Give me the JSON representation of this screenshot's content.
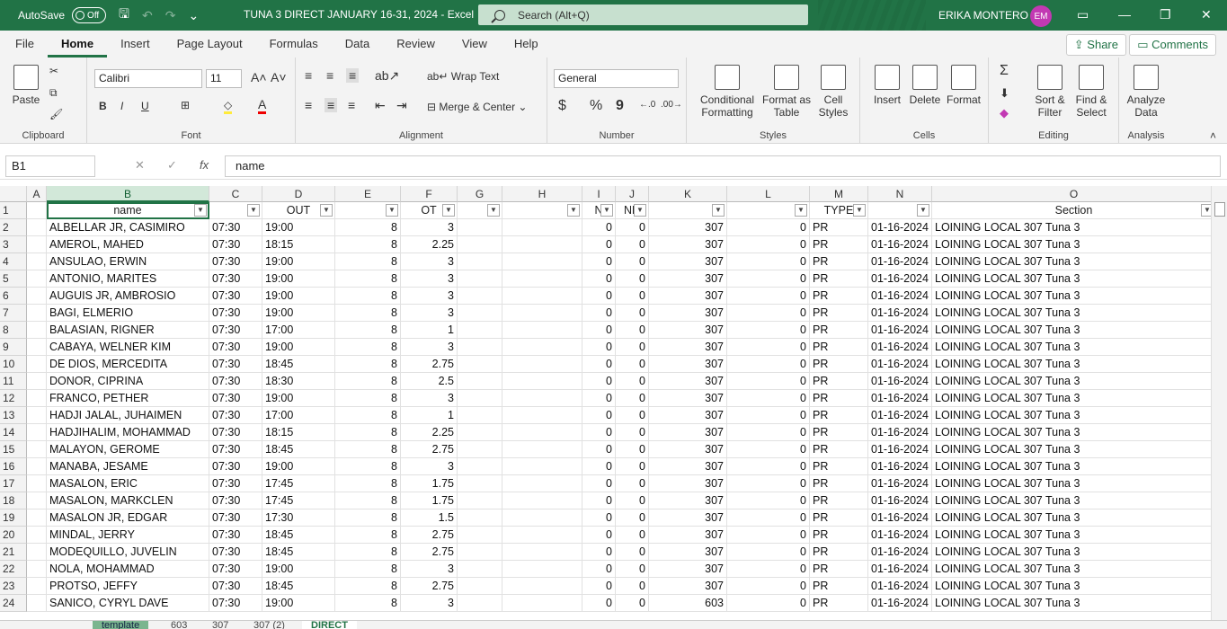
{
  "titlebar": {
    "autosave_label": "AutoSave",
    "autosave_state": "Off",
    "doc_title": "TUNA 3 DIRECT  JANUARY 16-31, 2024  -  Excel",
    "search_placeholder": "Search (Alt+Q)",
    "user_name": "ERIKA MONTERO",
    "user_initials": "EM"
  },
  "menu": [
    "File",
    "Home",
    "Insert",
    "Page Layout",
    "Formulas",
    "Data",
    "Review",
    "View",
    "Help"
  ],
  "share_label": "Share",
  "comments_label": "Comments",
  "ribbon": {
    "clipboard": {
      "paste": "Paste",
      "label": "Clipboard"
    },
    "font": {
      "name": "Calibri",
      "size": "11",
      "label": "Font",
      "bold": "B",
      "italic": "I",
      "underline": "U"
    },
    "alignment": {
      "wrap": "Wrap Text",
      "merge": "Merge & Center",
      "label": "Alignment"
    },
    "number": {
      "format": "General",
      "currency": "$",
      "percent": "%",
      "comma": "9",
      "label": "Number"
    },
    "styles": {
      "conditional": "Conditional Formatting",
      "format_table": "Format as Table",
      "cell_styles": "Cell Styles",
      "label": "Styles"
    },
    "cells": {
      "insert": "Insert",
      "delete": "Delete",
      "format": "Format",
      "label": "Cells"
    },
    "editing": {
      "sort": "Sort & Filter",
      "find": "Find & Select",
      "label": "Editing"
    },
    "analysis": {
      "analyze": "Analyze Data",
      "label": "Analysis"
    }
  },
  "formula_bar": {
    "name_box": "B1",
    "fx": "fx",
    "content": "name"
  },
  "columns": [
    "A",
    "B",
    "C",
    "D",
    "E",
    "F",
    "G",
    "H",
    "I",
    "J",
    "K",
    "L",
    "M",
    "N",
    "O"
  ],
  "header_row": {
    "B": "name",
    "D": "OUT",
    "F": "OT",
    "I": "N",
    "J": "ND",
    "M": "TYPE",
    "O": "Section"
  },
  "rows": [
    {
      "num": "2",
      "B": "ALBELLAR JR, CASIMIRO",
      "C": "07:30",
      "D": "19:00",
      "E": "8",
      "F": "3",
      "I": "0",
      "J": "0",
      "K": "307",
      "L": "0",
      "M": "PR",
      "N": "01-16-2024",
      "O": "LOINING LOCAL 307 Tuna 3"
    },
    {
      "num": "3",
      "B": "AMEROL, MAHED",
      "C": "07:30",
      "D": "18:15",
      "E": "8",
      "F": "2.25",
      "I": "0",
      "J": "0",
      "K": "307",
      "L": "0",
      "M": "PR",
      "N": "01-16-2024",
      "O": "LOINING LOCAL 307 Tuna 3"
    },
    {
      "num": "4",
      "B": "ANSULAO, ERWIN",
      "C": "07:30",
      "D": "19:00",
      "E": "8",
      "F": "3",
      "I": "0",
      "J": "0",
      "K": "307",
      "L": "0",
      "M": "PR",
      "N": "01-16-2024",
      "O": "LOINING LOCAL 307 Tuna 3"
    },
    {
      "num": "5",
      "B": "ANTONIO, MARITES",
      "C": "07:30",
      "D": "19:00",
      "E": "8",
      "F": "3",
      "I": "0",
      "J": "0",
      "K": "307",
      "L": "0",
      "M": "PR",
      "N": "01-16-2024",
      "O": "LOINING LOCAL 307 Tuna 3"
    },
    {
      "num": "6",
      "B": "AUGUIS JR, AMBROSIO",
      "C": "07:30",
      "D": "19:00",
      "E": "8",
      "F": "3",
      "I": "0",
      "J": "0",
      "K": "307",
      "L": "0",
      "M": "PR",
      "N": "01-16-2024",
      "O": "LOINING LOCAL 307 Tuna 3"
    },
    {
      "num": "7",
      "B": "BAGI, ELMERIO",
      "C": "07:30",
      "D": "19:00",
      "E": "8",
      "F": "3",
      "I": "0",
      "J": "0",
      "K": "307",
      "L": "0",
      "M": "PR",
      "N": "01-16-2024",
      "O": "LOINING LOCAL 307 Tuna 3"
    },
    {
      "num": "8",
      "B": "BALASIAN, RIGNER",
      "C": "07:30",
      "D": "17:00",
      "E": "8",
      "F": "1",
      "I": "0",
      "J": "0",
      "K": "307",
      "L": "0",
      "M": "PR",
      "N": "01-16-2024",
      "O": "LOINING LOCAL 307 Tuna 3"
    },
    {
      "num": "9",
      "B": "CABAYA, WELNER KIM",
      "C": "07:30",
      "D": "19:00",
      "E": "8",
      "F": "3",
      "I": "0",
      "J": "0",
      "K": "307",
      "L": "0",
      "M": "PR",
      "N": "01-16-2024",
      "O": "LOINING LOCAL 307 Tuna 3"
    },
    {
      "num": "10",
      "B": "DE DIOS, MERCEDITA",
      "C": "07:30",
      "D": "18:45",
      "E": "8",
      "F": "2.75",
      "I": "0",
      "J": "0",
      "K": "307",
      "L": "0",
      "M": "PR",
      "N": "01-16-2024",
      "O": "LOINING LOCAL 307 Tuna 3"
    },
    {
      "num": "11",
      "B": "DONOR, CIPRINA",
      "C": "07:30",
      "D": "18:30",
      "E": "8",
      "F": "2.5",
      "I": "0",
      "J": "0",
      "K": "307",
      "L": "0",
      "M": "PR",
      "N": "01-16-2024",
      "O": "LOINING LOCAL 307 Tuna 3"
    },
    {
      "num": "12",
      "B": "FRANCO, PETHER",
      "C": "07:30",
      "D": "19:00",
      "E": "8",
      "F": "3",
      "I": "0",
      "J": "0",
      "K": "307",
      "L": "0",
      "M": "PR",
      "N": "01-16-2024",
      "O": "LOINING LOCAL 307 Tuna 3"
    },
    {
      "num": "13",
      "B": "HADJI JALAL, JUHAIMEN",
      "C": "07:30",
      "D": "17:00",
      "E": "8",
      "F": "1",
      "I": "0",
      "J": "0",
      "K": "307",
      "L": "0",
      "M": "PR",
      "N": "01-16-2024",
      "O": "LOINING LOCAL 307 Tuna 3"
    },
    {
      "num": "14",
      "B": "HADJIHALIM, MOHAMMAD",
      "C": "07:30",
      "D": "18:15",
      "E": "8",
      "F": "2.25",
      "I": "0",
      "J": "0",
      "K": "307",
      "L": "0",
      "M": "PR",
      "N": "01-16-2024",
      "O": "LOINING LOCAL 307 Tuna 3"
    },
    {
      "num": "15",
      "B": "MALAYON, GEROME",
      "C": "07:30",
      "D": "18:45",
      "E": "8",
      "F": "2.75",
      "I": "0",
      "J": "0",
      "K": "307",
      "L": "0",
      "M": "PR",
      "N": "01-16-2024",
      "O": "LOINING LOCAL 307 Tuna 3"
    },
    {
      "num": "16",
      "B": "MANABA, JESAME",
      "C": "07:30",
      "D": "19:00",
      "E": "8",
      "F": "3",
      "I": "0",
      "J": "0",
      "K": "307",
      "L": "0",
      "M": "PR",
      "N": "01-16-2024",
      "O": "LOINING LOCAL 307 Tuna 3"
    },
    {
      "num": "17",
      "B": "MASALON, ERIC",
      "C": "07:30",
      "D": "17:45",
      "E": "8",
      "F": "1.75",
      "I": "0",
      "J": "0",
      "K": "307",
      "L": "0",
      "M": "PR",
      "N": "01-16-2024",
      "O": "LOINING LOCAL 307 Tuna 3"
    },
    {
      "num": "18",
      "B": "MASALON, MARKCLEN",
      "C": "07:30",
      "D": "17:45",
      "E": "8",
      "F": "1.75",
      "I": "0",
      "J": "0",
      "K": "307",
      "L": "0",
      "M": "PR",
      "N": "01-16-2024",
      "O": "LOINING LOCAL 307 Tuna 3"
    },
    {
      "num": "19",
      "B": "MASALON JR, EDGAR",
      "C": "07:30",
      "D": "17:30",
      "E": "8",
      "F": "1.5",
      "I": "0",
      "J": "0",
      "K": "307",
      "L": "0",
      "M": "PR",
      "N": "01-16-2024",
      "O": "LOINING LOCAL 307 Tuna 3"
    },
    {
      "num": "20",
      "B": "MINDAL, JERRY",
      "C": "07:30",
      "D": "18:45",
      "E": "8",
      "F": "2.75",
      "I": "0",
      "J": "0",
      "K": "307",
      "L": "0",
      "M": "PR",
      "N": "01-16-2024",
      "O": "LOINING LOCAL 307 Tuna 3"
    },
    {
      "num": "21",
      "B": "MODEQUILLO, JUVELIN",
      "C": "07:30",
      "D": "18:45",
      "E": "8",
      "F": "2.75",
      "I": "0",
      "J": "0",
      "K": "307",
      "L": "0",
      "M": "PR",
      "N": "01-16-2024",
      "O": "LOINING LOCAL 307 Tuna 3"
    },
    {
      "num": "22",
      "B": "NOLA, MOHAMMAD",
      "C": "07:30",
      "D": "19:00",
      "E": "8",
      "F": "3",
      "I": "0",
      "J": "0",
      "K": "307",
      "L": "0",
      "M": "PR",
      "N": "01-16-2024",
      "O": "LOINING LOCAL 307 Tuna 3"
    },
    {
      "num": "23",
      "B": "PROTSO, JEFFY",
      "C": "07:30",
      "D": "18:45",
      "E": "8",
      "F": "2.75",
      "I": "0",
      "J": "0",
      "K": "307",
      "L": "0",
      "M": "PR",
      "N": "01-16-2024",
      "O": "LOINING LOCAL 307 Tuna 3"
    },
    {
      "num": "24",
      "B": "SANICO, CYRYL DAVE",
      "C": "07:30",
      "D": "19:00",
      "E": "8",
      "F": "3",
      "I": "0",
      "J": "0",
      "K": "603",
      "L": "0",
      "M": "PR",
      "N": "01-16-2024",
      "O": "LOINING LOCAL 307 Tuna 3"
    }
  ],
  "sheet_tabs": [
    "template",
    "603",
    "307",
    "307 (2)",
    "DIRECT"
  ],
  "colors": {
    "accent": "#217346",
    "selected_header": "#d2e8d9"
  }
}
